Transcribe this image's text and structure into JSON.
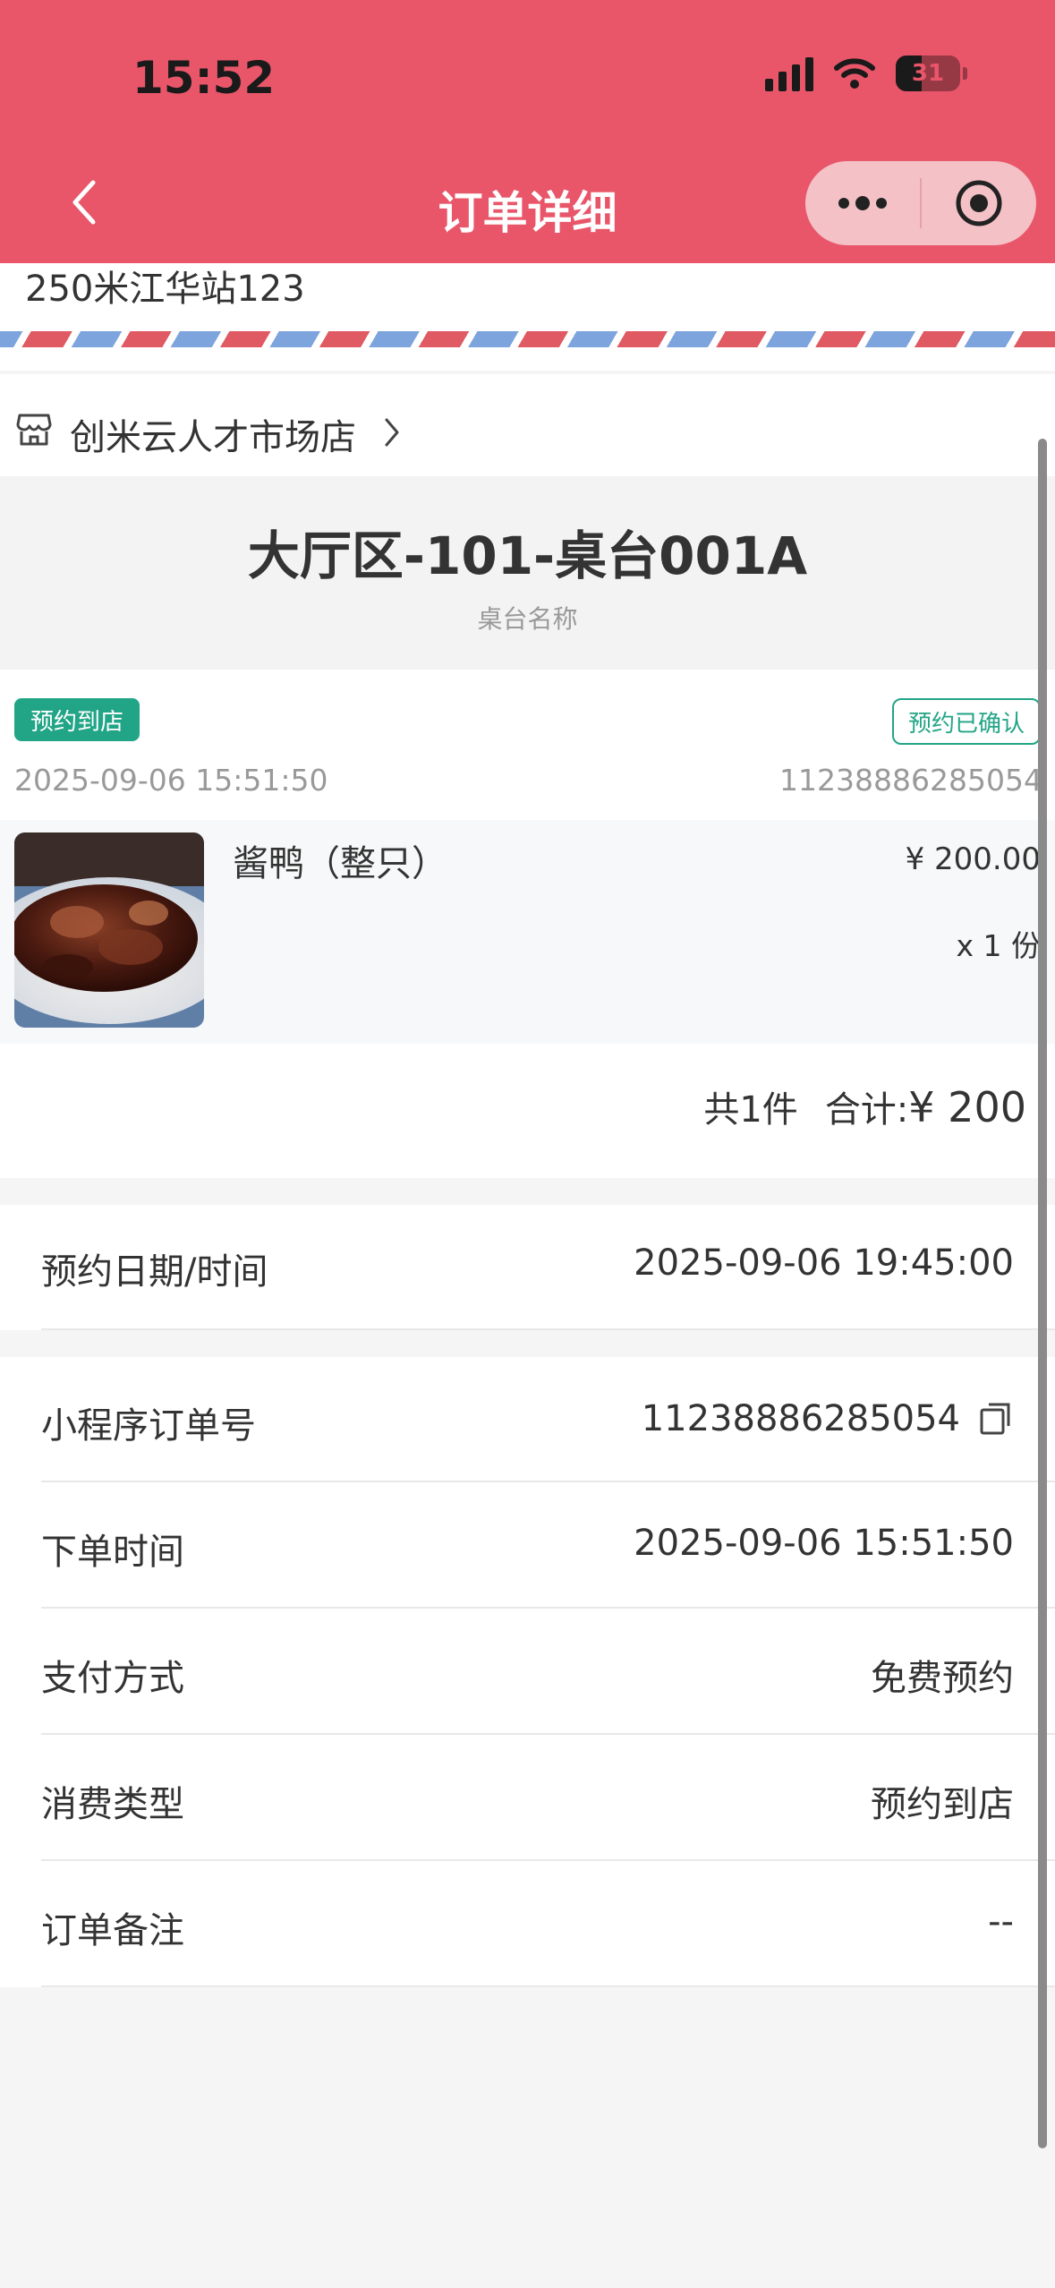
{
  "status_bar": {
    "time": "15:52",
    "battery": "31"
  },
  "nav": {
    "title": "订单详细",
    "back_icon": "chevron-left-icon",
    "more_icon": "more-dots-icon",
    "close_icon": "target-close-icon"
  },
  "address": {
    "text": "250米江华站123"
  },
  "store": {
    "name": "创米云人才市场店",
    "icon": "store-icon"
  },
  "table": {
    "name": "大厅区-101-桌台001A",
    "label": "桌台名称"
  },
  "order": {
    "type_badge": "预约到店",
    "status_badge": "预约已确认",
    "time": "2025-09-06 15:51:50",
    "number": "11238886285054"
  },
  "item": {
    "name": "酱鸭（整只）",
    "price": "¥ 200.00",
    "qty": "x 1 份"
  },
  "total": {
    "count": "共1件",
    "label": "合计:",
    "amount": "¥ 200"
  },
  "booking": {
    "label": "预约日期/时间",
    "value": "2025-09-06 19:45:00"
  },
  "details": [
    {
      "label": "小程序订单号",
      "value": "11238886285054"
    },
    {
      "label": "下单时间",
      "value": "2025-09-06 15:51:50"
    },
    {
      "label": "支付方式",
      "value": "免费预约"
    },
    {
      "label": "消费类型",
      "value": "预约到店"
    },
    {
      "label": "订单备注",
      "value": "--"
    }
  ],
  "colors": {
    "header": "#e9566a",
    "accent": "#22a587"
  }
}
